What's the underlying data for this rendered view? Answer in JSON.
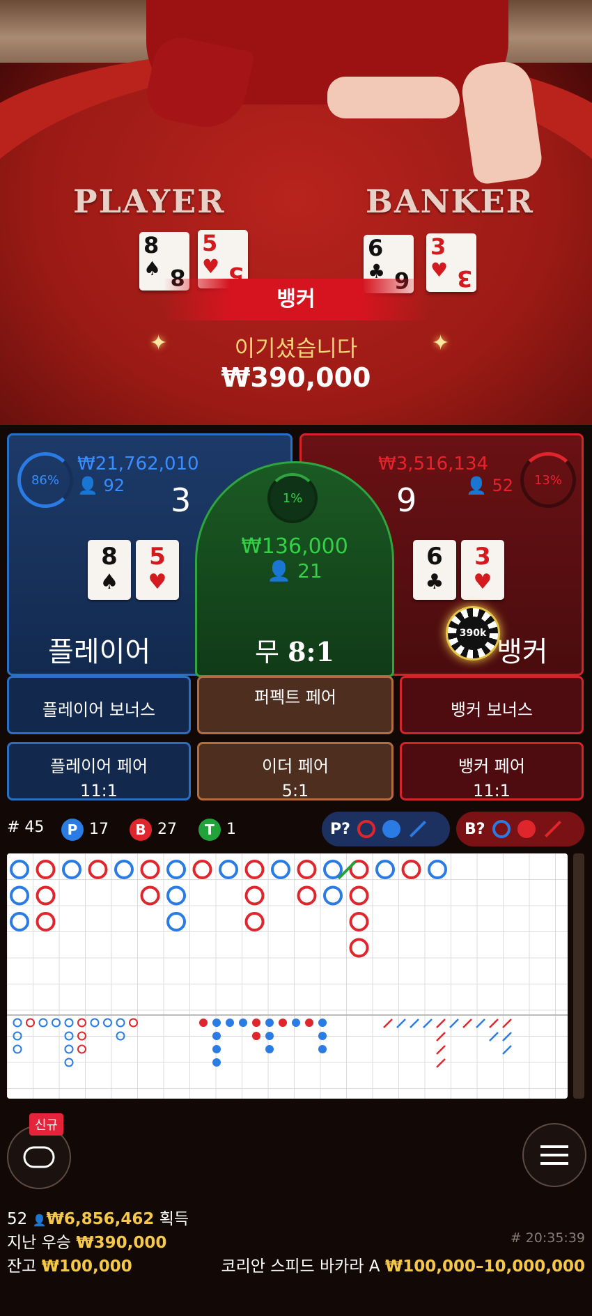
{
  "table": {
    "player_label": "PLAYER",
    "banker_label": "BANKER",
    "player_cards": [
      {
        "rank": "8",
        "suit": "♠",
        "color": "black"
      },
      {
        "rank": "5",
        "suit": "♥",
        "color": "red"
      }
    ],
    "banker_cards": [
      {
        "rank": "6",
        "suit": "♣",
        "color": "black"
      },
      {
        "rank": "3",
        "suit": "♥",
        "color": "red"
      }
    ]
  },
  "result": {
    "winner": "뱅커",
    "message": "이기셨습니다",
    "amount": "₩390,000"
  },
  "player": {
    "percent": "86%",
    "total_bet": "₩21,762,010",
    "players": "92",
    "score": "3",
    "label": "플레이어",
    "cards": [
      {
        "rank": "8",
        "suit": "♠",
        "color": "black"
      },
      {
        "rank": "5",
        "suit": "♥",
        "color": "red"
      }
    ]
  },
  "tie": {
    "percent": "1%",
    "total_bet": "₩136,000",
    "players": "21",
    "label": "무",
    "odds": "8:1"
  },
  "banker": {
    "percent": "13%",
    "total_bet": "₩3,516,134",
    "players": "52",
    "score": "9",
    "label": "뱅커",
    "chip": "390k",
    "cards": [
      {
        "rank": "6",
        "suit": "♣",
        "color": "black"
      },
      {
        "rank": "3",
        "suit": "♥",
        "color": "red"
      }
    ]
  },
  "side_bets": {
    "player_bonus": "플레이어 보너스",
    "perfect_pair": "퍼펙트 페어",
    "banker_bonus": "뱅커 보너스",
    "player_pair": "플레이어 페어",
    "player_pair_odds": "11:1",
    "either_pair": "이더 페어",
    "either_pair_odds": "5:1",
    "banker_pair": "뱅커 페어",
    "banker_pair_odds": "11:1"
  },
  "stats": {
    "round": "# 45",
    "player_letter": "P",
    "player_count": "17",
    "banker_letter": "B",
    "banker_count": "27",
    "tie_letter": "T",
    "tie_count": "1",
    "player_predict": "P?",
    "banker_predict": "B?"
  },
  "colors": {
    "player": "#2a7be4",
    "banker": "#e0262d",
    "tie": "#22a33a",
    "gold": "#f5c84a"
  },
  "bottom": {
    "new_badge": "신규",
    "chat_icon": "chat-bubble-icon",
    "menu_icon": "hamburger-menu-icon",
    "winners_count": "52",
    "winners_amount": "₩6,856,462",
    "winners_suffix": "획득",
    "last_win_label": "지난 우승",
    "last_win_amount": "₩390,000",
    "balance_label": "잔고",
    "balance_amount": "₩100,000",
    "game_id": "# 20:35:39",
    "table_name": "코리안 스피드 바카라 A",
    "limits": "₩100,000–10,000,000"
  }
}
